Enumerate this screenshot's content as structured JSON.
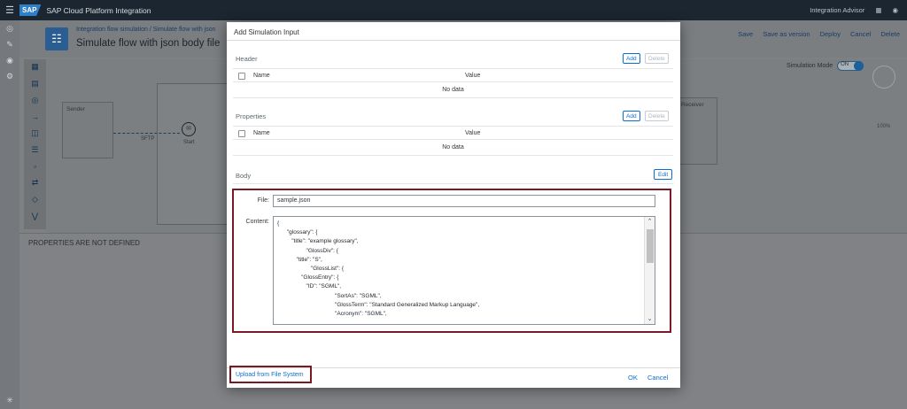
{
  "shell": {
    "logo": "SAP",
    "title": "SAP Cloud Platform Integration",
    "right_label": "Integration Advisor"
  },
  "page": {
    "breadcrumb": "Integration flow simulation / Simulate flow with json",
    "title": "Simulate flow with json body file",
    "actions": [
      "Save",
      "Save as version",
      "Deploy",
      "Cancel",
      "Delete"
    ]
  },
  "canvas": {
    "sender_label": "Sender",
    "receiver_label": "Receiver",
    "adapter_label": "SFTP",
    "start_label": "Start",
    "simulation_mode_label": "Simulation Mode",
    "simulation_mode_state": "ON",
    "zoom_level": "100%"
  },
  "properties_panel": {
    "message": "PROPERTIES ARE NOT DEFINED"
  },
  "dialog": {
    "title": "Add Simulation Input",
    "header_section": {
      "title": "Header",
      "add_label": "Add",
      "delete_label": "Delete",
      "col_name": "Name",
      "col_value": "Value",
      "empty_text": "No data"
    },
    "properties_section": {
      "title": "Properties",
      "add_label": "Add",
      "delete_label": "Delete",
      "col_name": "Name",
      "col_value": "Value",
      "empty_text": "No data"
    },
    "body_section": {
      "title": "Body",
      "edit_label": "Edit",
      "file_label": "File:",
      "file_value": "sample.json",
      "content_label": "Content:",
      "content_value": "{\n      \"glossary\": {\n         \"title\": \"example glossary\",\n                  \"GlossDiv\": {\n            \"title\": \"S\",\n                     \"GlossList\": {\n               \"GlossEntry\": {\n                  \"ID\": \"SGML\",\n                                    \"SortAs\": \"SGML\",\n                                    \"GlossTerm\": \"Standard Generalized Markup Language\",\n                                    \"Acronym\": \"SGML\","
    },
    "footer": {
      "upload_label": "Upload from File System",
      "ok_label": "OK",
      "cancel_label": "Cancel"
    }
  },
  "colors": {
    "accent": "#0a6ed1",
    "highlight_border": "#7a1a24",
    "shell_bg": "#1b2631"
  }
}
